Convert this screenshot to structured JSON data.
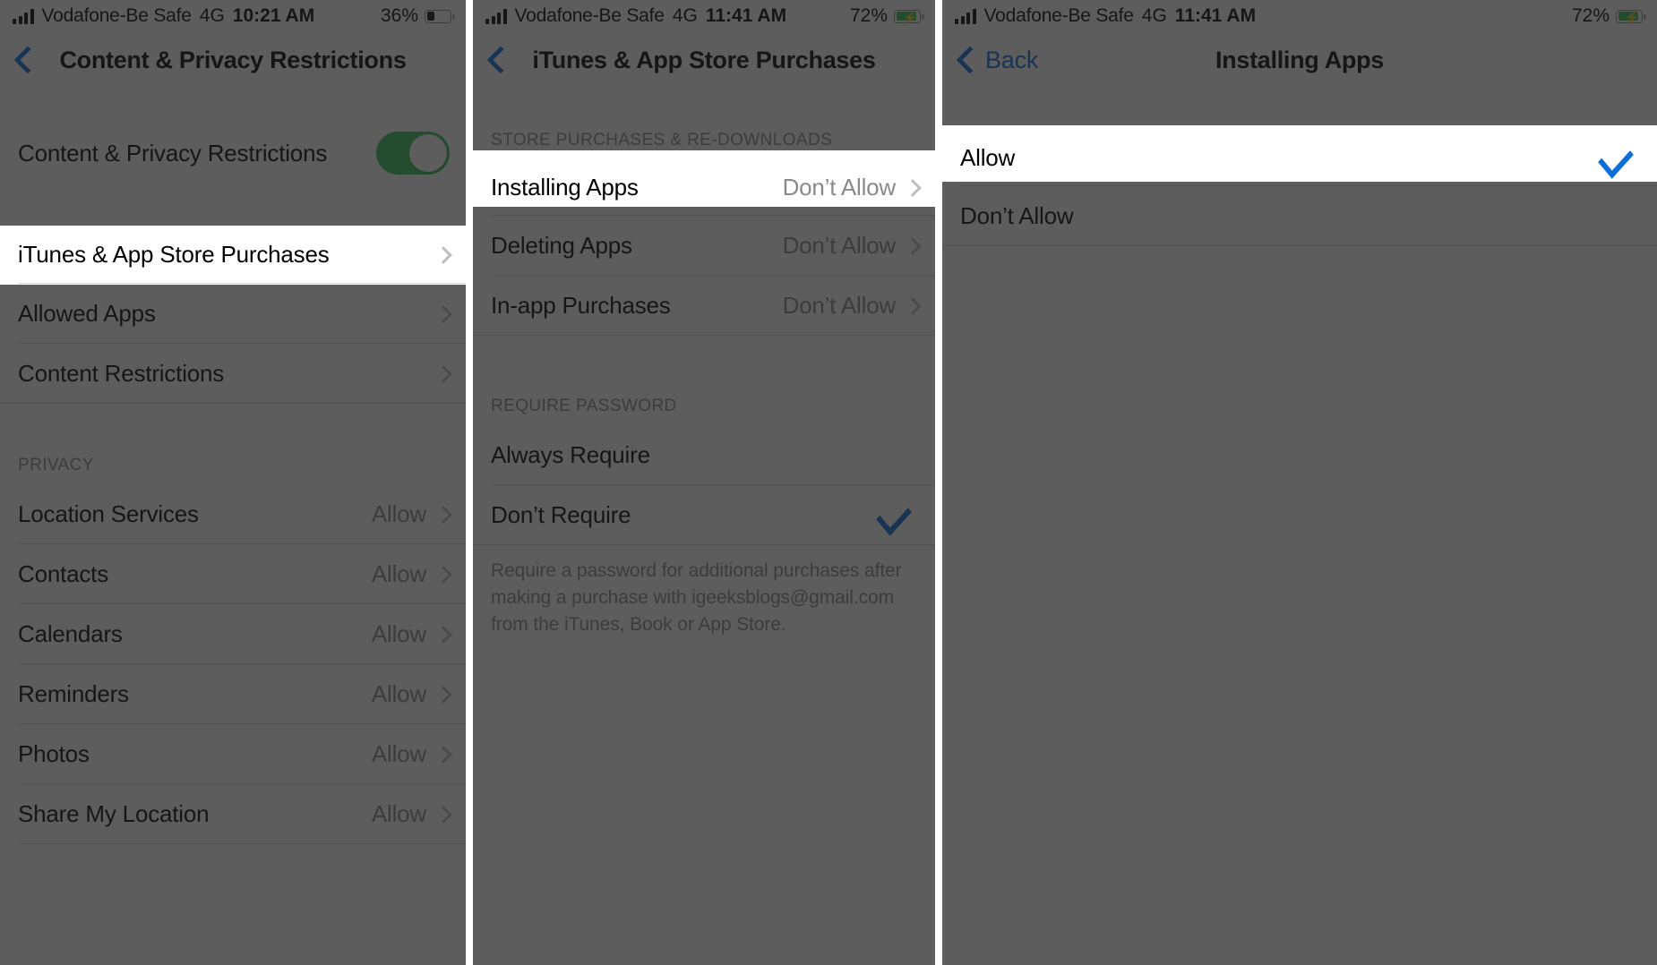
{
  "panels": [
    {
      "id": "content-privacy-restrictions",
      "status_bar": {
        "signal_icon": "cellular-bars-icon",
        "carrier": "Vodafone-Be Safe",
        "network": "4G",
        "time": "10:21 AM",
        "battery_percent": "36%",
        "battery_icon": "battery-low-icon",
        "charging": false
      },
      "nav": {
        "back_icon": "chevron-left-icon",
        "back_label": "",
        "title": "Content & Privacy Restrictions"
      },
      "rows": [
        {
          "label": "Content & Privacy Restrictions",
          "control": "toggle",
          "toggle_on": true,
          "highlighted": false
        },
        {
          "label": "iTunes & App Store Purchases",
          "control": "chevron",
          "value": "",
          "highlighted": true
        },
        {
          "label": "Allowed Apps",
          "control": "chevron",
          "value": "",
          "highlighted": false
        },
        {
          "label": "Content Restrictions",
          "control": "chevron",
          "value": "",
          "highlighted": false
        }
      ],
      "privacy_header": "PRIVACY",
      "privacy_rows": [
        {
          "label": "Location Services",
          "value": "Allow"
        },
        {
          "label": "Contacts",
          "value": "Allow"
        },
        {
          "label": "Calendars",
          "value": "Allow"
        },
        {
          "label": "Reminders",
          "value": "Allow"
        },
        {
          "label": "Photos",
          "value": "Allow"
        },
        {
          "label": "Share My Location",
          "value": "Allow"
        }
      ]
    },
    {
      "id": "itunes-app-store-purchases",
      "status_bar": {
        "signal_icon": "cellular-bars-icon",
        "carrier": "Vodafone-Be Safe",
        "network": "4G",
        "time": "11:41 AM",
        "battery_percent": "72%",
        "battery_icon": "battery-charging-icon",
        "charging": true
      },
      "nav": {
        "back_icon": "chevron-left-icon",
        "back_label": "",
        "title": "iTunes & App Store Purchases"
      },
      "section_header": "STORE PURCHASES & RE-DOWNLOADS",
      "store_rows": [
        {
          "label": "Installing Apps",
          "value": "Don’t Allow",
          "highlighted": true
        },
        {
          "label": "Deleting Apps",
          "value": "Don’t Allow",
          "highlighted": false
        },
        {
          "label": "In-app Purchases",
          "value": "Don’t Allow",
          "highlighted": false
        }
      ],
      "password_header": "REQUIRE PASSWORD",
      "password_rows": [
        {
          "label": "Always Require",
          "checked": false
        },
        {
          "label": "Don’t Require",
          "checked": true
        }
      ],
      "footnote": "Require a password for additional purchases after making a purchase with igeeksblogs@gmail.com from the iTunes, Book or App Store."
    },
    {
      "id": "installing-apps",
      "status_bar": {
        "signal_icon": "cellular-bars-icon",
        "carrier": "Vodafone-Be Safe",
        "network": "4G",
        "time": "11:41 AM",
        "battery_percent": "72%",
        "battery_icon": "battery-charging-icon",
        "charging": true
      },
      "nav": {
        "back_icon": "chevron-left-icon",
        "back_label": "Back",
        "title": "Installing Apps"
      },
      "options": [
        {
          "label": "Allow",
          "checked": true,
          "highlighted": true
        },
        {
          "label": "Don’t Allow",
          "checked": false,
          "highlighted": false
        }
      ]
    }
  ],
  "colors": {
    "accent_blue": "#0b6ed9",
    "toggle_green": "#34c759",
    "secondary_text": "#8a8a8e",
    "separator": "#d6d6da",
    "dim_overlay": "rgba(30,30,30,0.72)"
  }
}
